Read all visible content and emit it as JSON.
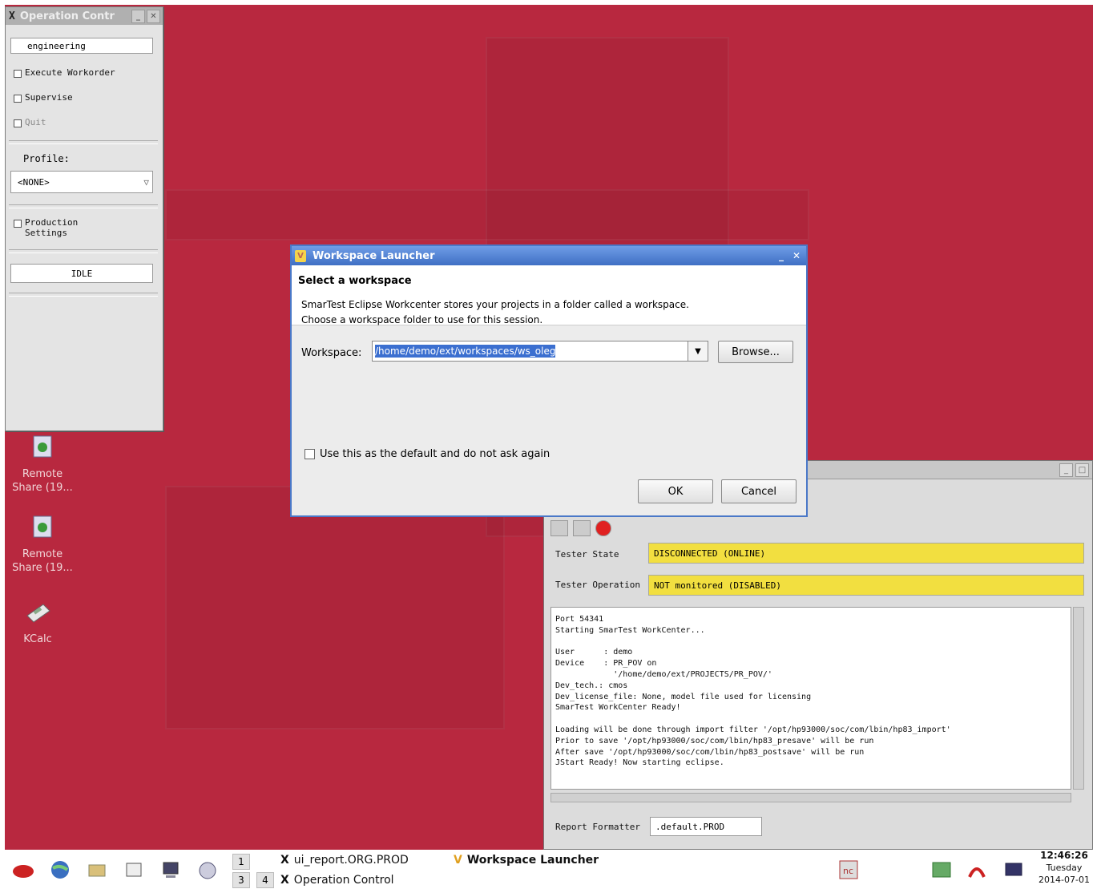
{
  "operation_control": {
    "title": "Operation Contr",
    "user": "engineering",
    "checks": [
      "Execute Workorder",
      "Supervise",
      "Quit"
    ],
    "profile_label": "Profile:",
    "profile_value": "<NONE>",
    "production_settings_line1": "Production",
    "production_settings_line2": "Settings",
    "state": "IDLE"
  },
  "desktop_icons": [
    {
      "label_line1": "Remote",
      "label_line2": "Share (19..."
    },
    {
      "label_line1": "Remote",
      "label_line2": "Share (19..."
    },
    {
      "label_line1": "KCalc",
      "label_line2": ""
    }
  ],
  "dialog": {
    "title": "Workspace Launcher",
    "heading": "Select a workspace",
    "desc_line1": "SmarTest Eclipse Workcenter stores your projects in a folder called a workspace.",
    "desc_line2": "Choose a workspace folder to use for this session.",
    "workspace_label": "Workspace:",
    "workspace_value": "/home/demo/ext/workspaces/ws_oleg",
    "browse_label": "Browse...",
    "default_checkbox_label": "Use this as the default and do not ask again",
    "default_checked": false,
    "ok_label": "OK",
    "cancel_label": "Cancel"
  },
  "terminal": {
    "tester_state_label": "Tester State",
    "tester_state_value": "DISCONNECTED (ONLINE)",
    "tester_operation_label": "Tester Operation",
    "tester_operation_value": "NOT monitored (DISABLED)",
    "log": "Port 54341\nStarting SmarTest WorkCenter...\n\nUser      : demo\nDevice    : PR_POV on\n            '/home/demo/ext/PROJECTS/PR_POV/'\nDev_tech.: cmos\nDev_license_file: None, model file used for licensing\nSmarTest WorkCenter Ready!\n\nLoading will be done through import filter '/opt/hp93000/soc/com/lbin/hp83_import'\nPrior to save '/opt/hp93000/soc/com/lbin/hp83_presave' will be run\nAfter save '/opt/hp93000/soc/com/lbin/hp83_postsave' will be run\nJStart Ready! Now starting eclipse.",
    "report_formatter_label": "Report Formatter",
    "report_formatter_value": ".default.PROD"
  },
  "taskbar": {
    "workspaces": [
      "1",
      "3",
      "4"
    ],
    "tasks": [
      "ui_report.ORG.PROD",
      "Workspace Launcher",
      "Operation Control"
    ],
    "clock_time": "12:46:26",
    "clock_day": "Tuesday",
    "clock_date": "2014-07-01",
    "status_colors": {
      "yellow": "#f2df40",
      "desktop": "#b8283f",
      "dialog_accent": "#4a78c8"
    }
  }
}
